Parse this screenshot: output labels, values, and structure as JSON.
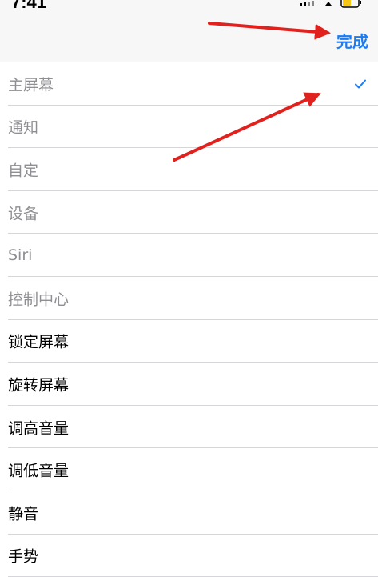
{
  "status_bar": {
    "time": "7:41"
  },
  "nav": {
    "done_label": "完成"
  },
  "menu_items": [
    {
      "label": "主屏幕",
      "enabled": false,
      "checked": true
    },
    {
      "label": "通知",
      "enabled": false,
      "checked": false
    },
    {
      "label": "自定",
      "enabled": false,
      "checked": false
    },
    {
      "label": "设备",
      "enabled": false,
      "checked": false
    },
    {
      "label": "Siri",
      "enabled": false,
      "checked": false
    },
    {
      "label": "控制中心",
      "enabled": false,
      "checked": false
    },
    {
      "label": "锁定屏幕",
      "enabled": true,
      "checked": false
    },
    {
      "label": "旋转屏幕",
      "enabled": true,
      "checked": false
    },
    {
      "label": "调高音量",
      "enabled": true,
      "checked": false
    },
    {
      "label": "调低音量",
      "enabled": true,
      "checked": false
    },
    {
      "label": "静音",
      "enabled": true,
      "checked": false
    },
    {
      "label": "手势",
      "enabled": true,
      "checked": false
    }
  ],
  "colors": {
    "accent": "#1a7cf4",
    "annotation_arrow": "#e0211d"
  }
}
